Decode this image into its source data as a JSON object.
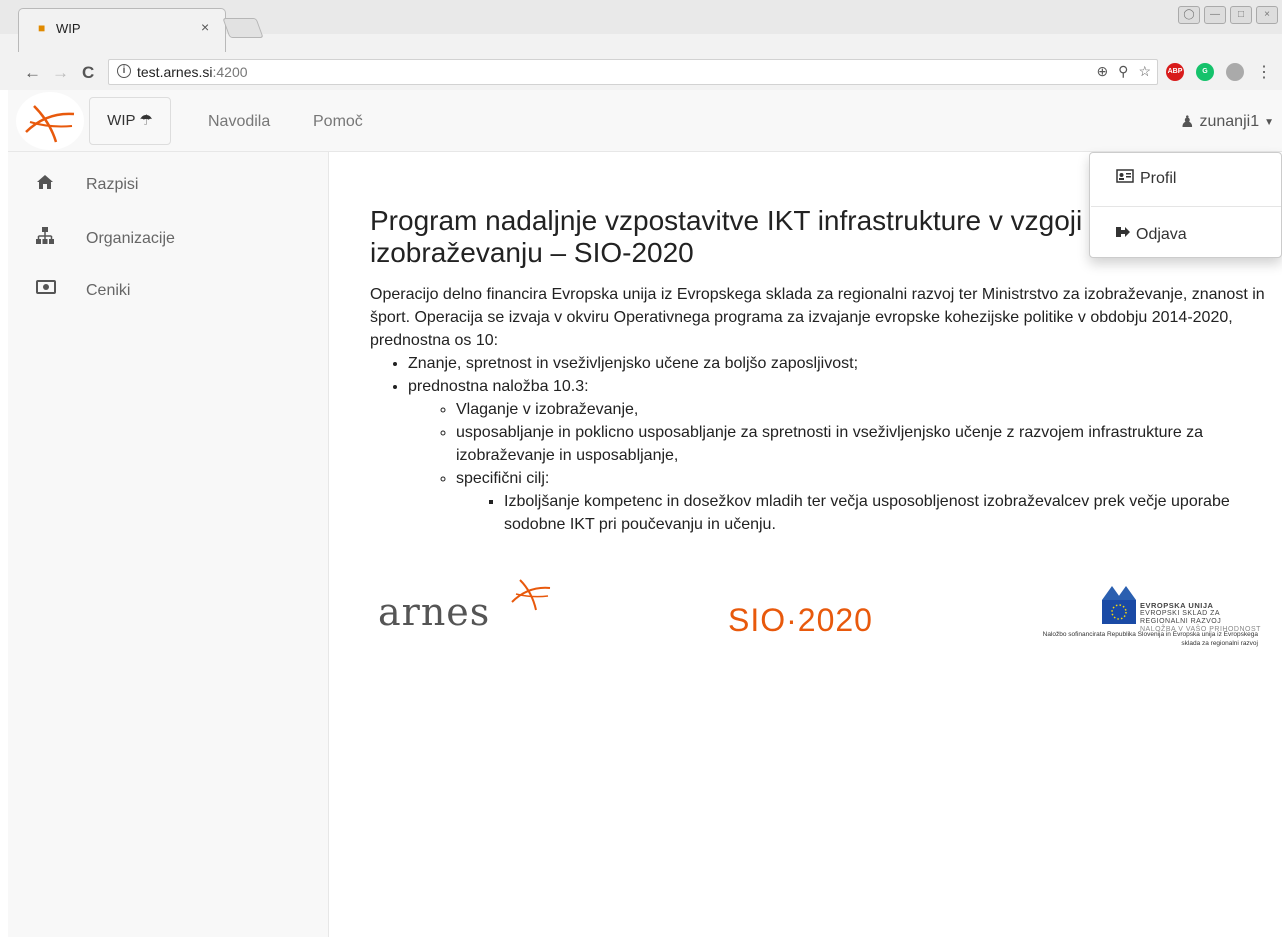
{
  "browser": {
    "tab_title": "WIP",
    "url_host": "test.arnes.si",
    "url_port": ":4200",
    "extensions": [
      "ABP",
      "G",
      ""
    ]
  },
  "navbar": {
    "brand": "WIP",
    "links": [
      "Navodila",
      "Pomoč"
    ],
    "user": "zunanji1"
  },
  "sidebar": {
    "items": [
      {
        "label": "Razpisi",
        "icon": "home-icon"
      },
      {
        "label": "Organizacije",
        "icon": "sitemap-icon"
      },
      {
        "label": "Ceniki",
        "icon": "money-icon"
      }
    ]
  },
  "dropdown": {
    "items": [
      {
        "label": "Profil",
        "icon": "id-card-icon"
      },
      {
        "label": "Odjava",
        "icon": "sign-out-icon"
      }
    ]
  },
  "content": {
    "title": "Program nadaljnje vzpostavitve IKT infrastrukture v vzgoji in izobraževanju – SIO-2020",
    "intro": "Operacijo delno financira Evropska unija iz Evropskega sklada za regionalni razvoj ter Ministrstvo za izobraževanje, znanost in šport. Operacija se izvaja v okviru Operativnega programa za izvajanje evropske kohezijske politike v obdobju 2014-2020, prednostna os 10:",
    "l1": [
      "Znanje, spretnost in vseživljenjsko učene za boljšo zaposljivost;",
      "prednostna naložba 10.3:"
    ],
    "l2": [
      "Vlaganje v izobraževanje,",
      "usposabljanje in poklicno usposabljanje za spretnosti in vseživljenjsko učenje z razvojem infrastrukture za izobraževanje in usposabljanje,",
      "specifični cilj:"
    ],
    "l3": [
      "Izboljšanje kompetenc in dosežkov mladih ter večja usposobljenost izobraževalcev prek večje uporabe sodobne IKT pri poučevanju in učenju."
    ]
  },
  "logos": {
    "arnes": "arnes",
    "sio": "SIO·2020",
    "eu_title": "EVROPSKA UNIJA",
    "eu_sub1": "EVROPSKI SKLAD ZA",
    "eu_sub2": "REGIONALNI RAZVOJ",
    "eu_sub3": "NALOŽBA V VAŠO PRIHODNOST",
    "eu_note": "Naložbo sofinancirata Republika Slovenija in Evropska unija iz Evropskega sklada za regionalni razvoj"
  },
  "colors": {
    "accent_orange": "#e8590c",
    "navbar_bg": "#f8f8f8"
  }
}
